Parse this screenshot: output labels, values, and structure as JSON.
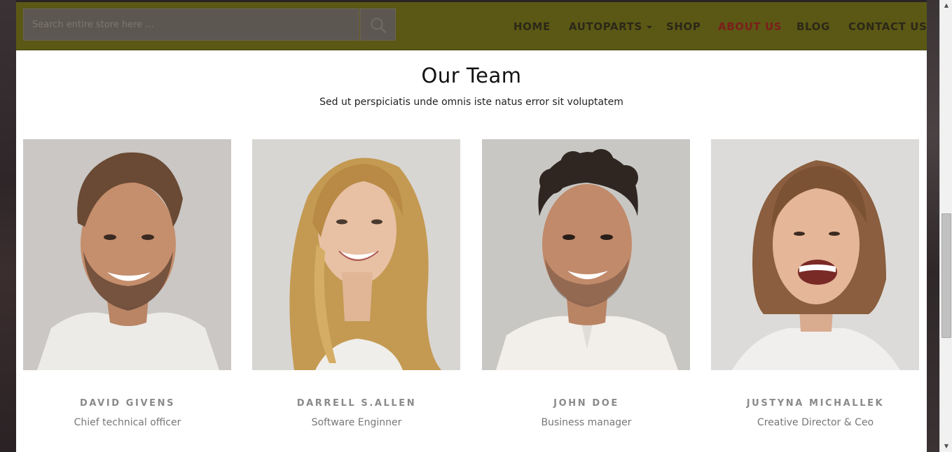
{
  "search": {
    "placeholder": "Search entire store here ..."
  },
  "nav": {
    "items": [
      {
        "label": "HOME",
        "active": false
      },
      {
        "label": "AUTOPARTS",
        "active": false,
        "dropdown": true
      },
      {
        "label": "SHOP",
        "active": false
      },
      {
        "label": "ABOUT US",
        "active": true
      },
      {
        "label": "BLOG",
        "active": false
      },
      {
        "label": "CONTACT US",
        "active": false
      }
    ]
  },
  "section": {
    "title": "Our Team",
    "subtitle": "Sed ut perspiciatis unde omnis iste natus error sit voluptatem"
  },
  "team": [
    {
      "name": "DAVID GIVENS",
      "role": "Chief technical officer"
    },
    {
      "name": "DARRELL S.ALLEN",
      "role": "Software Enginner"
    },
    {
      "name": "JOHN DOE",
      "role": "Business manager"
    },
    {
      "name": "JUSTYNA MICHALLEK",
      "role": "Creative Director & Ceo"
    }
  ],
  "colors": {
    "header_bg": "#5b5815",
    "active_nav": "#7a1f1a",
    "nav_text": "#2c2818",
    "name_text": "#8a8a8a"
  },
  "icons": {
    "search": "search-icon",
    "dropdown": "caret-down-icon"
  }
}
